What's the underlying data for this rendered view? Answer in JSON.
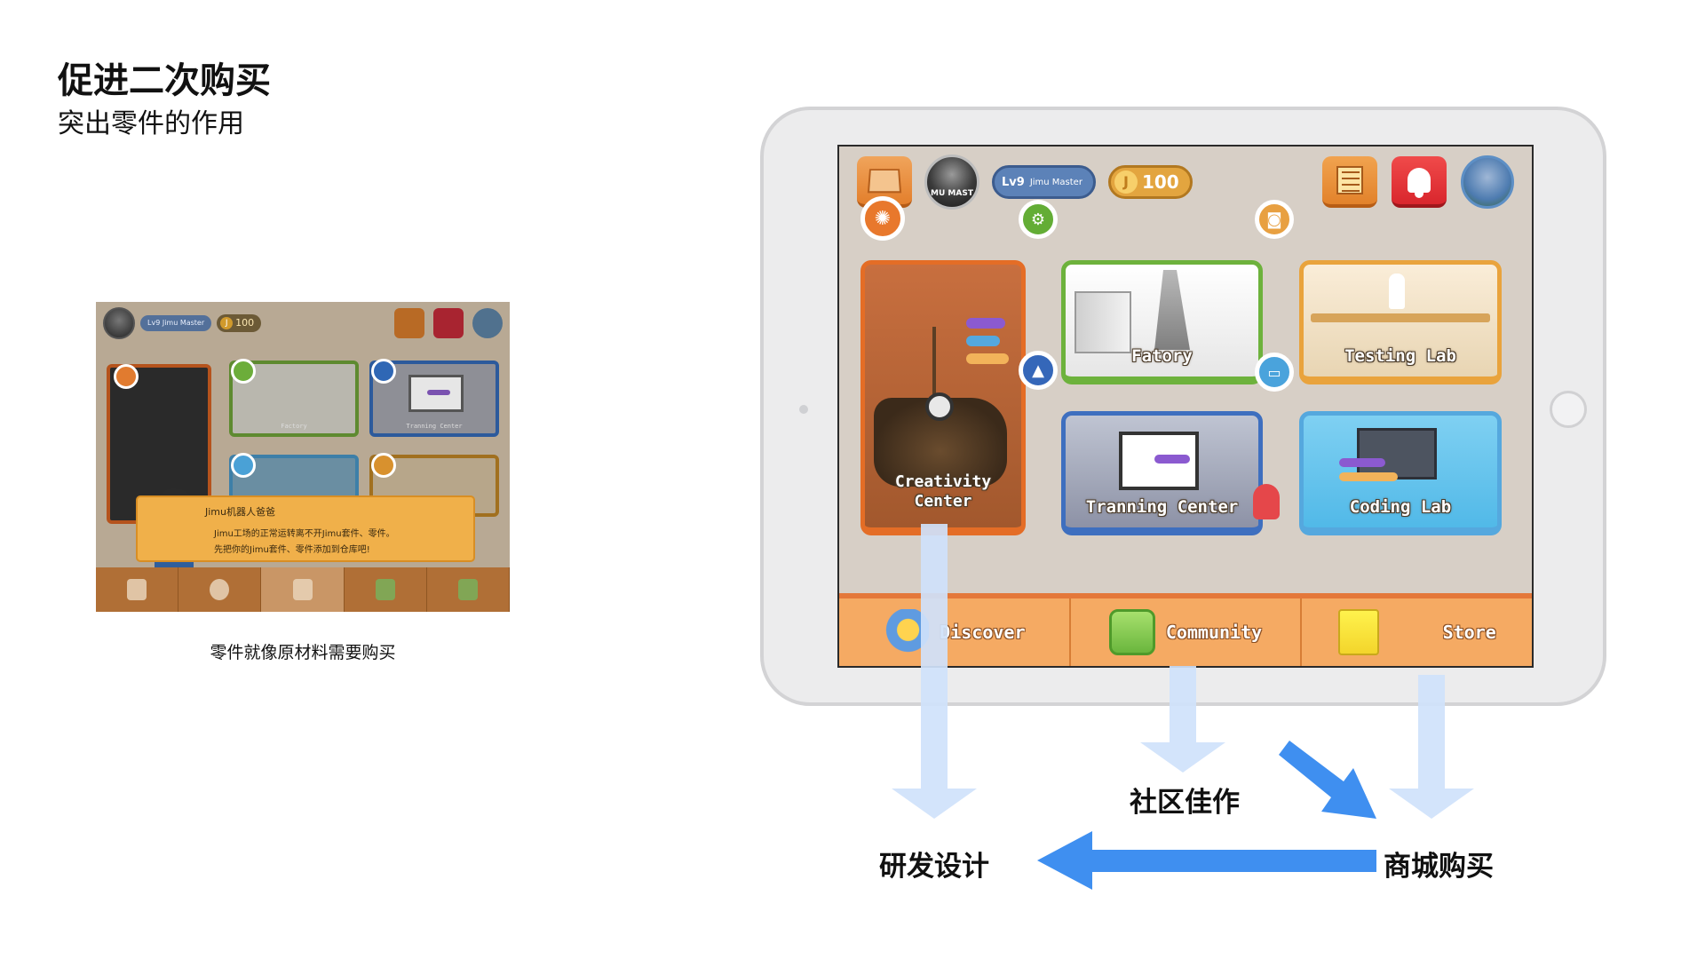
{
  "header": {
    "title": "促进二次购买",
    "subtitle": "突出零件的作用"
  },
  "mini_screenshot": {
    "top": {
      "level": "Lv9",
      "name": "Jimu Master",
      "coins": "100"
    },
    "cards": {
      "factory": "Factory",
      "training": "Tranning Center"
    },
    "dialog": {
      "speaker": "Jimu机器人爸爸",
      "line1": "Jimu工场的正常运转离不开Jimu套件、零件。",
      "line2": "先把你的Jimu套件、零件添加到仓库吧!"
    },
    "caption": "零件就像原材料需要购买"
  },
  "app": {
    "top": {
      "avatar_text": "MU MAST",
      "level": "Lv9",
      "player_name": "Jimu Master",
      "coin_symbol": "J",
      "coins": "100"
    },
    "cards": {
      "creativity": "Creativity Center",
      "factory": "Fatory",
      "testing": "Testing Lab",
      "training": "Tranning Center",
      "coding": "Coding Lab"
    },
    "tabs": {
      "discover": "Discover",
      "community": "Community",
      "store": "Store"
    }
  },
  "flow": {
    "design": "研发设计",
    "community_works": "社区佳作",
    "store_purchase": "商城购买"
  },
  "colors": {
    "accent_orange": "#f5aa63",
    "arrow_light_blue": "#cfe2fb",
    "arrow_blue": "#3f8ff0"
  }
}
